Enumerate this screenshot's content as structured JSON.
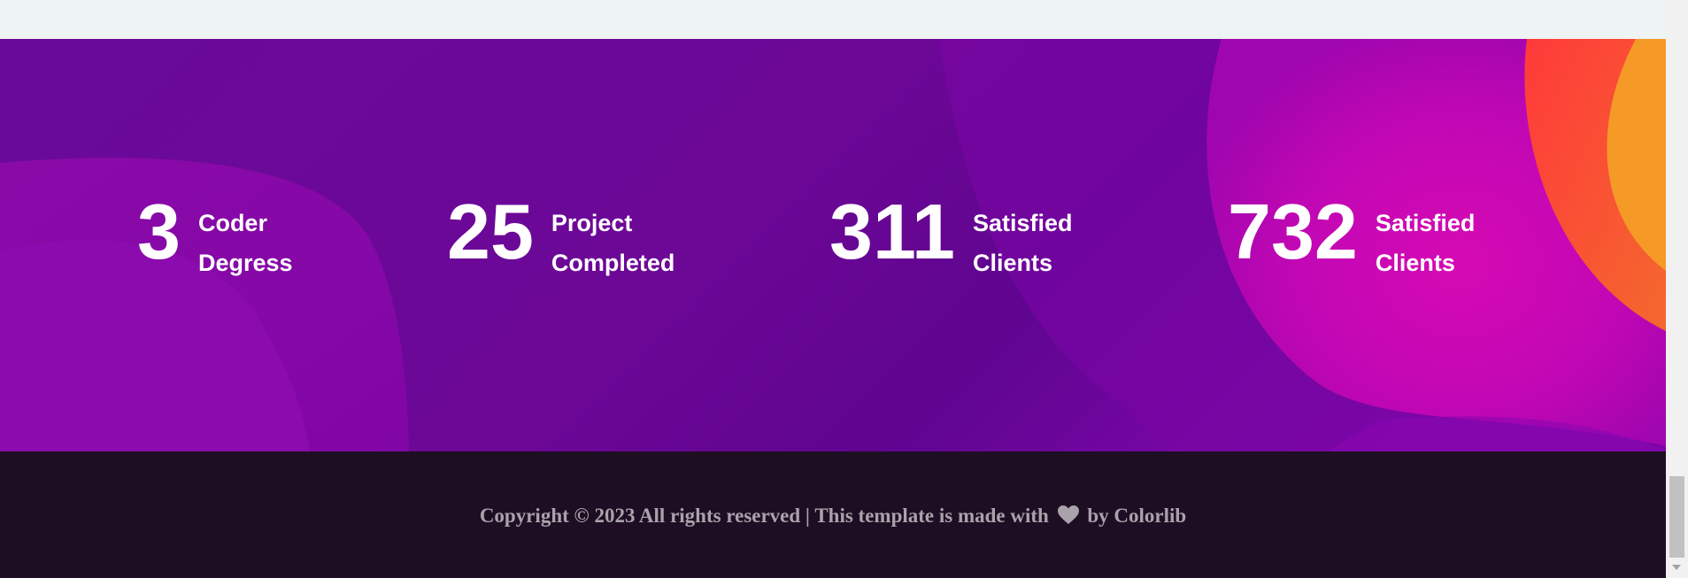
{
  "stats": [
    {
      "number": "3",
      "label_line1": "Coder",
      "label_line2": "Degress"
    },
    {
      "number": "25",
      "label_line1": "Project",
      "label_line2": "Completed"
    },
    {
      "number": "311",
      "label_line1": "Satisfied",
      "label_line2": "Clients"
    },
    {
      "number": "732",
      "label_line1": "Satisfied",
      "label_line2": "Clients"
    }
  ],
  "footer": {
    "copyright_prefix": "Copyright © 2023 All rights reserved | This template is made with",
    "heart_icon": "heart-icon",
    "copyright_suffix": "by Colorlib"
  },
  "colors": {
    "section_purple": "#6a0a9a",
    "magenta": "#c807b4",
    "orange": "#f39527",
    "footer_bg": "#1e0e23",
    "footer_text": "#a9a2ab"
  }
}
